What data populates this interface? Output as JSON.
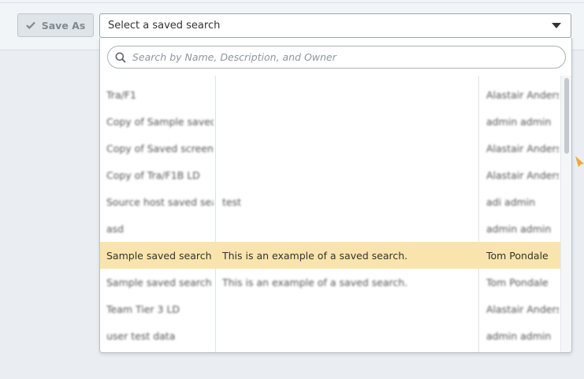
{
  "toolbar": {
    "save_as_label": "Save As",
    "select_label": "Select a saved search"
  },
  "dropdown": {
    "search_placeholder": "Search by Name, Description, and Owner",
    "rows": [
      {
        "name": "Tra/F1",
        "description": "",
        "owner": "Alastair Anderson",
        "selected": false
      },
      {
        "name": "Copy of Sample saved search",
        "description": "",
        "owner": "admin admin",
        "selected": false
      },
      {
        "name": "Copy of Saved screen search",
        "description": "",
        "owner": "Alastair Anderson",
        "selected": false
      },
      {
        "name": "Copy of Tra/F1B LD",
        "description": "",
        "owner": "Alastair Anderson",
        "selected": false
      },
      {
        "name": "Source host saved search",
        "description": "test",
        "owner": "adi admin",
        "selected": false
      },
      {
        "name": "asd",
        "description": "",
        "owner": "admin admin",
        "selected": false
      },
      {
        "name": "Sample saved search",
        "description": "This is an example of a saved search.",
        "owner": "Tom Pondale",
        "selected": true
      },
      {
        "name": "Sample saved search",
        "description": "This is an example of a saved search.",
        "owner": "Tom Pondale",
        "selected": false
      },
      {
        "name": "Team Tier 3 LD",
        "description": "",
        "owner": "Alastair Anderson",
        "selected": false
      },
      {
        "name": "user test data",
        "description": "",
        "owner": "admin admin",
        "selected": false
      }
    ]
  },
  "colors": {
    "selected_row": "#fae4ad",
    "accent_arrow": "#f0a830"
  },
  "icons": {
    "save_as": "check-icon",
    "select": "caret-down-icon",
    "search": "search-icon"
  }
}
